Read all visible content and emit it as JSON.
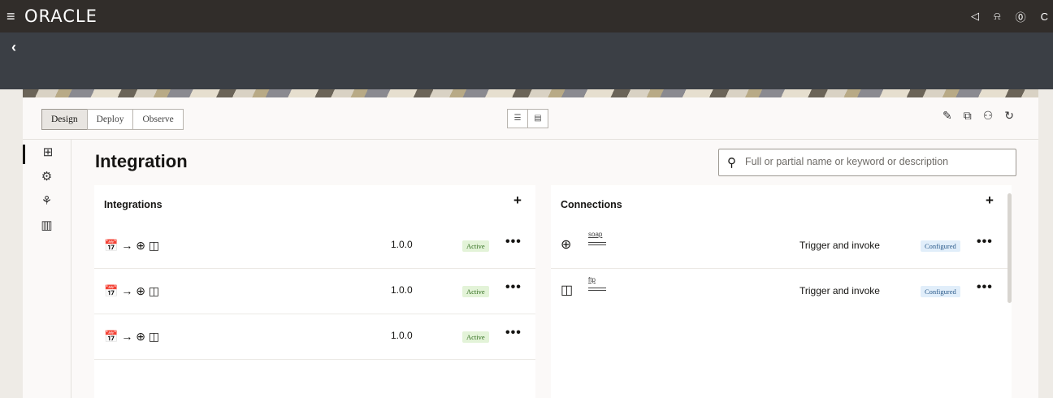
{
  "header": {
    "menu_icon": "hamburger-icon",
    "logo": "ORACLE",
    "icons": [
      "announcement-icon",
      "notification-bell-icon",
      "help-icon"
    ],
    "user_initial": "C"
  },
  "nav": {
    "back_icon": "chevron-left-icon"
  },
  "toolbar": {
    "tabs": [
      {
        "label": "Design",
        "selected": true
      },
      {
        "label": "Deploy",
        "selected": false
      },
      {
        "label": "Observe",
        "selected": false
      }
    ],
    "view_toggle": [
      "list-view-icon",
      "detail-view-icon"
    ],
    "actions": [
      "edit-icon",
      "open-external-icon",
      "users-icon",
      "refresh-icon"
    ]
  },
  "sidebar": {
    "items": [
      {
        "icon": "integrations-grid-icon",
        "active": true
      },
      {
        "icon": "connections-icon",
        "active": false
      },
      {
        "icon": "adapters-icon",
        "active": false
      },
      {
        "icon": "building-icon",
        "active": false
      }
    ]
  },
  "page": {
    "title": "Integration",
    "search_placeholder": "Full or partial name or keyword or description"
  },
  "integrations": {
    "title": "Integrations",
    "add_label": "+",
    "rows": [
      {
        "icons": "📅 → ⊕ ◫",
        "version": "1.0.0",
        "status": "Active"
      },
      {
        "icons": "📅 → ⊕ ◫",
        "version": "1.0.0",
        "status": "Active"
      },
      {
        "icons": "📅 → ⊕ ◫",
        "version": "1.0.0",
        "status": "Active"
      }
    ],
    "more_label": "•••"
  },
  "connections": {
    "title": "Connections",
    "add_label": "+",
    "rows": [
      {
        "icon": "globe-gear-icon",
        "type": "soap",
        "role": "Trigger and invoke",
        "status": "Configured"
      },
      {
        "icon": "folder-gear-icon",
        "type": "ftp",
        "role": "Trigger and invoke",
        "status": "Configured"
      }
    ],
    "more_label": "•••"
  }
}
